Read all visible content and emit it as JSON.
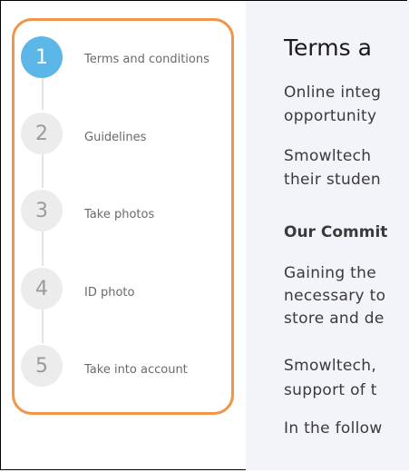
{
  "steps": [
    {
      "number": "1",
      "label": "Terms and conditions",
      "active": true
    },
    {
      "number": "2",
      "label": "Guidelines",
      "active": false
    },
    {
      "number": "3",
      "label": "Take photos",
      "active": false
    },
    {
      "number": "4",
      "label": "ID photo",
      "active": false
    },
    {
      "number": "5",
      "label": "Take into account",
      "active": false
    }
  ],
  "content": {
    "title": "Terms a",
    "p1": [
      "Online integ",
      "opportunity"
    ],
    "p2": [
      "Smowltech ",
      "their studen"
    ],
    "heading": "Our Commit",
    "p3": [
      "Gaining the",
      "necessary to",
      "store and de"
    ],
    "p4": [
      "Smowltech,",
      "support of t"
    ],
    "p5": [
      "In the follow"
    ]
  },
  "colors": {
    "active_step": "#5cb6e8",
    "inactive_step": "#ececec",
    "highlight": "#f0954a"
  }
}
